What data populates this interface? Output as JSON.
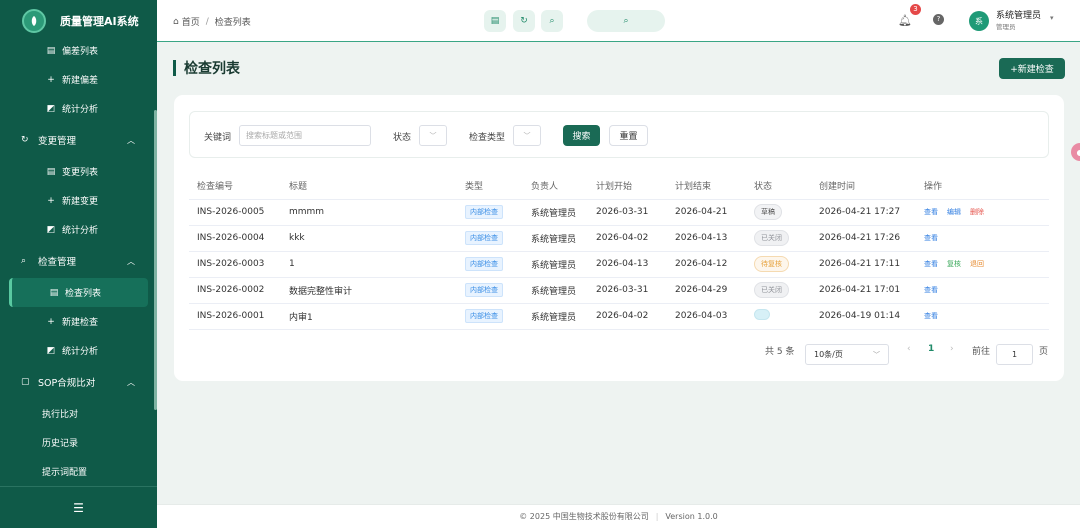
{
  "app": {
    "title": "质量管理AI系统"
  },
  "sidebar": {
    "deviation_items": [
      {
        "label": "偏差列表",
        "icon": "list-icon"
      },
      {
        "label": "新建偏差",
        "icon": "plus-icon"
      },
      {
        "label": "统计分析",
        "icon": "chart-icon"
      }
    ],
    "change_group": {
      "label": "变更管理",
      "icon": "refresh-icon"
    },
    "change_items": [
      {
        "label": "变更列表",
        "icon": "list-icon"
      },
      {
        "label": "新建变更",
        "icon": "plus-icon"
      },
      {
        "label": "统计分析",
        "icon": "chart-icon"
      }
    ],
    "inspection_group": {
      "label": "检查管理",
      "icon": "search-icon"
    },
    "inspection_items": [
      {
        "label": "检查列表",
        "icon": "list-icon",
        "active": true
      },
      {
        "label": "新建检查",
        "icon": "plus-icon"
      },
      {
        "label": "统计分析",
        "icon": "chart-icon"
      }
    ],
    "sop_group": {
      "label": "SOP合规比对",
      "icon": "document-icon"
    },
    "sop_items": [
      {
        "label": "执行比对"
      },
      {
        "label": "历史记录"
      },
      {
        "label": "提示词配置"
      }
    ],
    "collapse_icon": "menu-icon"
  },
  "header": {
    "breadcrumb": {
      "home": "首页",
      "current": "检查列表"
    },
    "notification_count": "3",
    "user": {
      "avatar_text": "系",
      "name": "系统管理员",
      "role": "管理员"
    }
  },
  "main": {
    "title": "检查列表",
    "new_button": "+新建检查",
    "filter": {
      "keyword_label": "关键词",
      "keyword_placeholder": "搜索标题或范围",
      "status_label": "状态",
      "type_label": "检查类型",
      "search_button": "搜索",
      "reset_button": "重置"
    },
    "table": {
      "columns": [
        "检查编号",
        "标题",
        "类型",
        "负责人",
        "计划开始",
        "计划结束",
        "状态",
        "创建时间",
        "操作"
      ],
      "rows": [
        {
          "id": "INS-2026-0005",
          "title": "mmmm",
          "type": "内部检查",
          "owner": "系统管理员",
          "start": "2026-03-31",
          "end": "2026-04-21",
          "status": "草稿",
          "status_style": "draft",
          "created": "2026-04-21 17:27",
          "ops": [
            {
              "label": "查看",
              "kind": "view"
            },
            {
              "label": "编辑",
              "kind": "edit"
            },
            {
              "label": "删除",
              "kind": "del"
            }
          ]
        },
        {
          "id": "INS-2026-0004",
          "title": "kkk",
          "type": "内部检查",
          "owner": "系统管理员",
          "start": "2026-04-02",
          "end": "2026-04-13",
          "status": "已关闭",
          "status_style": "closed",
          "created": "2026-04-21 17:26",
          "ops": [
            {
              "label": "查看",
              "kind": "view"
            }
          ]
        },
        {
          "id": "INS-2026-0003",
          "title": "1",
          "type": "内部检查",
          "owner": "系统管理员",
          "start": "2026-04-13",
          "end": "2026-04-12",
          "status": "待复核",
          "status_style": "pending",
          "created": "2026-04-21 17:11",
          "ops": [
            {
              "label": "查看",
              "kind": "view"
            },
            {
              "label": "复核",
              "kind": "review"
            },
            {
              "label": "退回",
              "kind": "back"
            }
          ]
        },
        {
          "id": "INS-2026-0002",
          "title": "数据完整性审计",
          "type": "内部检查",
          "owner": "系统管理员",
          "start": "2026-03-31",
          "end": "2026-04-29",
          "status": "已关闭",
          "status_style": "closed",
          "created": "2026-04-21 17:01",
          "ops": [
            {
              "label": "查看",
              "kind": "view"
            }
          ]
        },
        {
          "id": "INS-2026-0001",
          "title": "内审1",
          "type": "内部检查",
          "owner": "系统管理员",
          "start": "2026-04-02",
          "end": "2026-04-03",
          "status": "",
          "status_style": "blank",
          "created": "2026-04-19 01:14",
          "ops": [
            {
              "label": "查看",
              "kind": "view"
            }
          ]
        }
      ]
    },
    "pagination": {
      "total": "共 5 条",
      "page_size": "10条/页",
      "current_page": "1",
      "jump_prefix": "前往",
      "jump_value": "1",
      "jump_suffix": "页"
    }
  },
  "footer": {
    "copyright": "© 2025 中国生物技术股份有限公司",
    "version": "Version 1.0.0"
  },
  "colors": {
    "sidebar": "#0f5a48",
    "accent": "#1a6a55",
    "link": "#2f7de1",
    "danger": "#e5534b"
  }
}
